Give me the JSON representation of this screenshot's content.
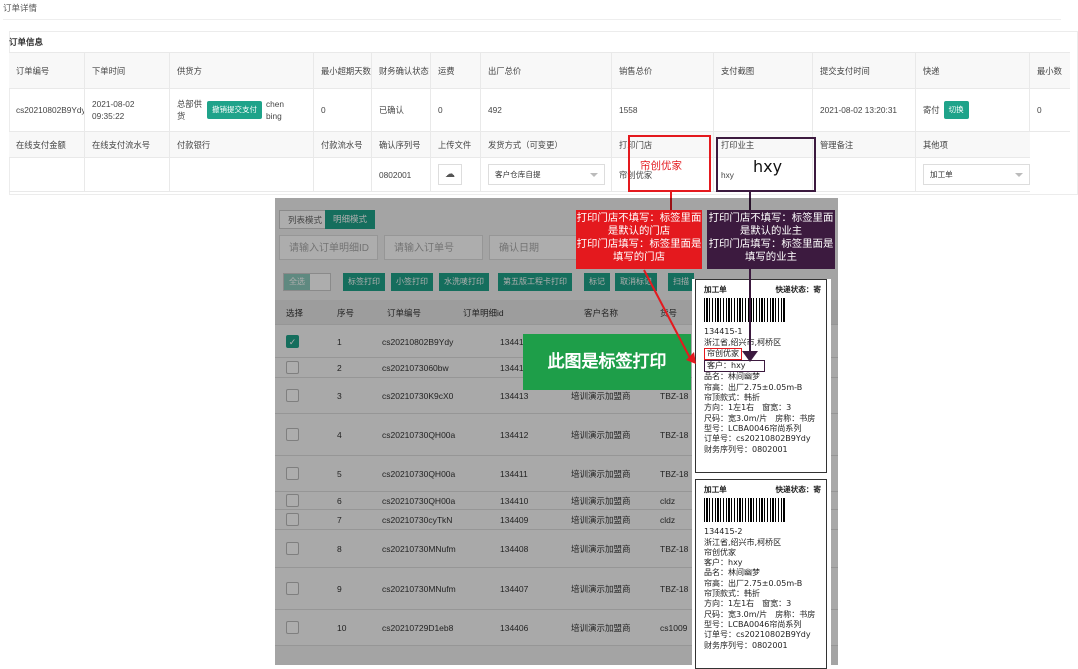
{
  "page": {
    "title": "订单详情"
  },
  "section": {
    "title": "订单信息"
  },
  "head1": [
    "订单编号",
    "下单时间",
    "供货方",
    "最小超期天数",
    "财务确认状态",
    "运费",
    "出厂总价",
    "销售总价",
    "支付截图",
    "提交支付时间",
    "快递",
    "最小数"
  ],
  "data1": {
    "order_no": "cs20210802B9Ydy",
    "order_time": "2021-08-02 09:35:22",
    "supplier_prefix": "总部供货",
    "supplier_btn": "撤销提交支付",
    "supplier_suffix": "chen bing",
    "min_days": "0",
    "finance_status": "已确认",
    "freight": "0",
    "factory_total": "492",
    "sales_total": "1558",
    "pay_screenshot": "",
    "pay_time": "2021-08-02 13:20:31",
    "express": "寄付",
    "express_btn": "切换",
    "min_last": "0"
  },
  "head2": [
    "在线支付金额",
    "在线支付流水号",
    "付款银行",
    "付款流水号",
    "确认序列号",
    "上传文件",
    "发货方式（可变更）",
    "打印门店",
    "打印业主",
    "管理备注",
    "其他项"
  ],
  "data2": {
    "confirm_serial": "0802001",
    "ship_method": "客户仓库自提",
    "print_store": "帘创优家",
    "print_owner": "hxy",
    "other": "加工单"
  },
  "annot": {
    "store_red": "帘创优家",
    "owner_big": "hxy",
    "callout_store": "打印门店不填写：标签里面是默认的门店\n打印门店填写：标签里面是填写的门店",
    "callout_owner": "打印门店不填写：标签里面是默认的业主\n打印门店填写：标签里面是填写的业主",
    "green": "此图是标签打印"
  },
  "shot": {
    "tabs": [
      "列表模式",
      "明细模式"
    ],
    "inputs": [
      "请输入订单明细ID",
      "请输入订单号",
      "确认日期"
    ],
    "all": "全选",
    "buttons": [
      "标签打印",
      "小签打印",
      "水洗唛打印",
      "第五版工程卡打印",
      "标记",
      "取消标记",
      "扫描"
    ],
    "headers": [
      "选择",
      "序号",
      "订单编号",
      "订单明细id",
      "客户名称",
      "货号"
    ],
    "rows": [
      {
        "idx": "1",
        "order": "cs20210802B9Ydy",
        "id": "13441",
        "cust": "",
        "code": "",
        "checked": true
      },
      {
        "idx": "2",
        "order": "cs2021073060bw",
        "id": "13441",
        "cust": "",
        "code": "",
        "checked": false
      },
      {
        "idx": "3",
        "order": "cs20210730K9cX0",
        "id": "134413",
        "cust": "培训演示加盟商",
        "code": "TBZ-18",
        "checked": false
      },
      {
        "idx": "4",
        "order": "cs20210730QH00a",
        "id": "134412",
        "cust": "培训演示加盟商",
        "code": "TBZ-18",
        "checked": false
      },
      {
        "idx": "5",
        "order": "cs20210730QH00a",
        "id": "134411",
        "cust": "培训演示加盟商",
        "code": "TBZ-18",
        "checked": false
      },
      {
        "idx": "6",
        "order": "cs20210730QH00a",
        "id": "134410",
        "cust": "培训演示加盟商",
        "code": "cldz",
        "checked": false
      },
      {
        "idx": "7",
        "order": "cs20210730cyTkN",
        "id": "134409",
        "cust": "培训演示加盟商",
        "code": "cldz",
        "checked": false
      },
      {
        "idx": "8",
        "order": "cs20210730MNufm",
        "id": "134408",
        "cust": "培训演示加盟商",
        "code": "TBZ-18",
        "checked": false
      },
      {
        "idx": "9",
        "order": "cs20210730MNufm",
        "id": "134407",
        "cust": "培训演示加盟商",
        "code": "TBZ-18",
        "checked": false
      },
      {
        "idx": "10",
        "order": "cs20210729D1eb8",
        "id": "134406",
        "cust": "培训演示加盟商",
        "code": "cs1009",
        "checked": false
      }
    ]
  },
  "labels": [
    {
      "type": "加工单",
      "status": "快递状态：寄",
      "id": "134415-1",
      "addr": "浙江省,绍兴市,柯桥区",
      "store": "帘创优家",
      "customer": "客户：hxy",
      "lines": [
        "品名：林间幽梦",
        "帘高：出厂2.75±0.05m-B",
        "帘顶款式：韩折",
        "方向：1左1右　窗宽：3",
        "尺码：宽3.0m/片　房称：书房",
        "型号：LCBA0046帘尚系列",
        "订单号：cs20210802B9Ydy",
        "财务序列号：0802001"
      ]
    },
    {
      "type": "加工单",
      "status": "快递状态：寄",
      "id": "134415-2",
      "addr": "浙江省,绍兴市,柯桥区",
      "store": "帘创优家",
      "customer": "客户：hxy",
      "lines": [
        "品名：林间幽梦",
        "帘高：出厂2.75±0.05m-B",
        "帘顶款式：韩折",
        "方向：1左1右　窗宽：3",
        "尺码：宽3.0m/片　房称：书房",
        "型号：LCBA0046帘尚系列",
        "订单号：cs20210802B9Ydy",
        "财务序列号：0802001"
      ]
    }
  ]
}
